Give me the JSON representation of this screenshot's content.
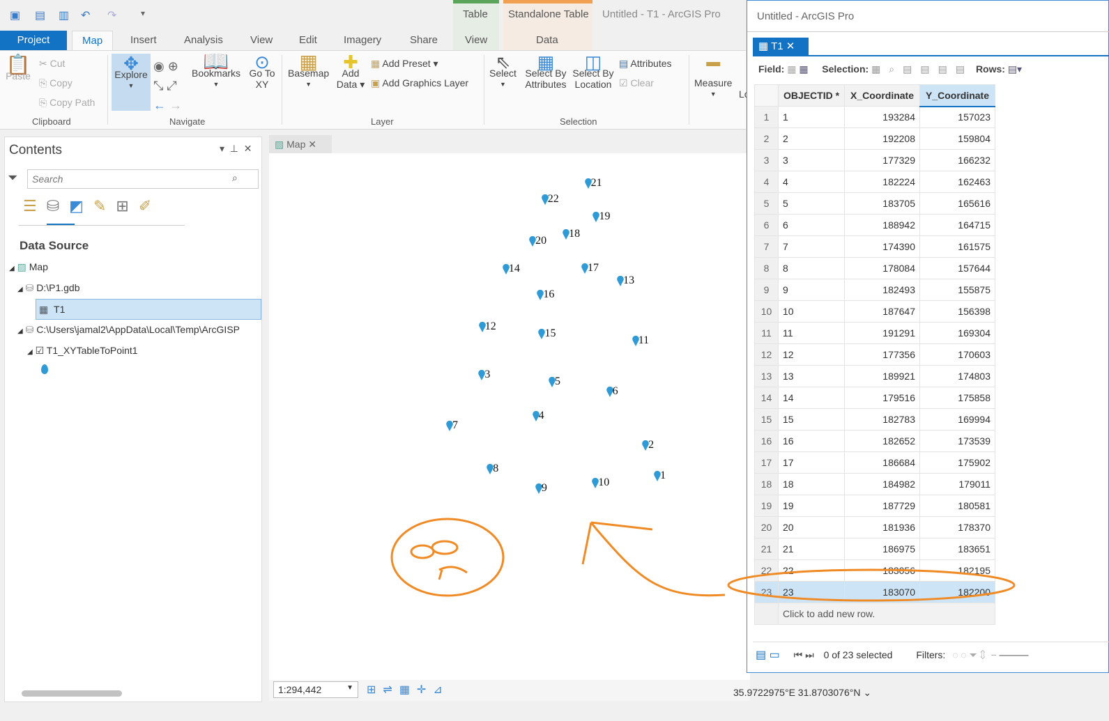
{
  "window": {
    "title": "Untitled - T1 - ArcGIS Pro",
    "table_window_title": "Untitled - ArcGIS Pro"
  },
  "contextual_tabs": [
    {
      "group": "Table",
      "tab": "View",
      "color": "#5aa55a"
    },
    {
      "group": "Standalone Table",
      "tab": "Data",
      "color": "#f0a050"
    }
  ],
  "tabs": [
    "Project",
    "Map",
    "Insert",
    "Analysis",
    "View",
    "Edit",
    "Imagery",
    "Share"
  ],
  "active_tab": "Map",
  "ribbon": {
    "clipboard": {
      "label": "Clipboard",
      "paste": "Paste",
      "cut": "Cut",
      "copy": "Copy",
      "copy_path": "Copy Path"
    },
    "navigate": {
      "label": "Navigate",
      "explore": "Explore",
      "bookmarks": "Bookmarks",
      "go_to_xy": "Go To XY"
    },
    "layer": {
      "label": "Layer",
      "basemap": "Basemap",
      "add_data": "Add Data",
      "add_preset": "Add Preset",
      "add_graphics_layer": "Add Graphics Layer"
    },
    "selection": {
      "label": "Selection",
      "select": "Select",
      "select_by_attributes": "Select By Attributes",
      "select_by_location": "Select By Location",
      "attributes": "Attributes",
      "clear": "Clear"
    },
    "inquiry": {
      "measure": "Measure",
      "locate": "Lo"
    }
  },
  "contents": {
    "title": "Contents",
    "search_placeholder": "Search",
    "section": "Data Source",
    "tree": [
      {
        "label": "Map"
      },
      {
        "label": "D:\\P1.gdb"
      },
      {
        "label": "T1",
        "selected": true
      },
      {
        "label": "C:\\Users\\jamal2\\AppData\\Local\\Temp\\ArcGISP"
      },
      {
        "label": "T1_XYTableToPoint1",
        "checked": true
      }
    ]
  },
  "map": {
    "tab": "Map",
    "scale": "1:294,442",
    "coordinates": "35.9722975°E 31.8703076°N",
    "marker_color": "#2e9bd6"
  },
  "table": {
    "tab": "T1",
    "field_label": "Field:",
    "selection_label": "Selection:",
    "rows_label": "Rows:",
    "columns": [
      "OBJECTID *",
      "X_Coordinate",
      "Y_Coordinate"
    ],
    "rows": [
      [
        1,
        193284,
        157023
      ],
      [
        2,
        192208,
        159804
      ],
      [
        3,
        177329,
        166232
      ],
      [
        4,
        182224,
        162463
      ],
      [
        5,
        183705,
        165616
      ],
      [
        6,
        188942,
        164715
      ],
      [
        7,
        174390,
        161575
      ],
      [
        8,
        178084,
        157644
      ],
      [
        9,
        182493,
        155875
      ],
      [
        10,
        187647,
        156398
      ],
      [
        11,
        191291,
        169304
      ],
      [
        12,
        177356,
        170603
      ],
      [
        13,
        189921,
        174803
      ],
      [
        14,
        179516,
        175858
      ],
      [
        15,
        182783,
        169994
      ],
      [
        16,
        182652,
        173539
      ],
      [
        17,
        186684,
        175902
      ],
      [
        18,
        184982,
        179011
      ],
      [
        19,
        187729,
        180581
      ],
      [
        20,
        181936,
        178370
      ],
      [
        21,
        186975,
        183651
      ],
      [
        22,
        183056,
        182195
      ],
      [
        23,
        183070,
        182200
      ]
    ],
    "selected_row": 23,
    "add_row": "Click to add new row.",
    "status": "0 of 23 selected",
    "filters": "Filters:"
  },
  "annotation_color": "#f08a24"
}
